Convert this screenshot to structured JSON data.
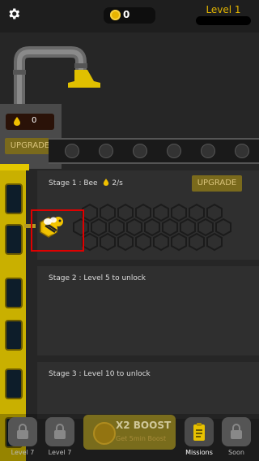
{
  "header": {
    "coins": "0",
    "level_label": "Level 1"
  },
  "machine": {
    "honey_value": "0",
    "upgrade_label": "UPGRADE"
  },
  "stages": [
    {
      "title": "Stage 1 : Bee",
      "rate": "2/s",
      "upgrade_label": "UPGRADE"
    },
    {
      "title": "Stage 2 : Level 5 to unlock"
    },
    {
      "title": "Stage 3 : Level 10 to unlock"
    }
  ],
  "bottom_nav": {
    "tab1_label": "Level 7",
    "tab2_label": "Level 7",
    "boost_title": "X2 BOOST",
    "boost_sub": "Get 5min Boost",
    "missions_label": "Missions",
    "soon_label": "Soon"
  },
  "colors": {
    "accent_gold": "#e3b500",
    "elevator_yellow": "#c9b000",
    "highlight_red": "#e00000"
  }
}
